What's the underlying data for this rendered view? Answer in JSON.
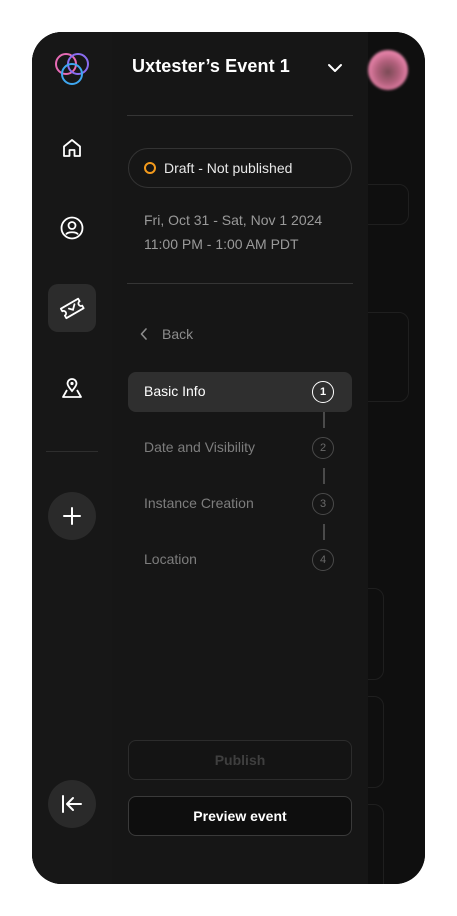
{
  "event": {
    "title": "Uxtester’s Event 1",
    "status": "Draft - Not published",
    "date_range": "Fri, Oct 31 - Sat, Nov 1 2024",
    "time_range": "11:00 PM - 1:00 AM PDT"
  },
  "nav": {
    "back_label": "Back",
    "steps": [
      {
        "label": "Basic Info",
        "number": "1",
        "active": true
      },
      {
        "label": "Date and Visibility",
        "number": "2",
        "active": false
      },
      {
        "label": "Instance Creation",
        "number": "3",
        "active": false
      },
      {
        "label": "Location",
        "number": "4",
        "active": false
      }
    ]
  },
  "actions": {
    "publish_label": "Publish",
    "preview_label": "Preview event"
  },
  "rail": {
    "items": [
      "home-icon",
      "profile-icon",
      "ticket-icon",
      "location-icon"
    ],
    "add_icon": "plus-icon",
    "collapse_icon": "collapse-left-icon"
  },
  "colors": {
    "status_accent": "#f39a1c",
    "background": "#161616"
  }
}
